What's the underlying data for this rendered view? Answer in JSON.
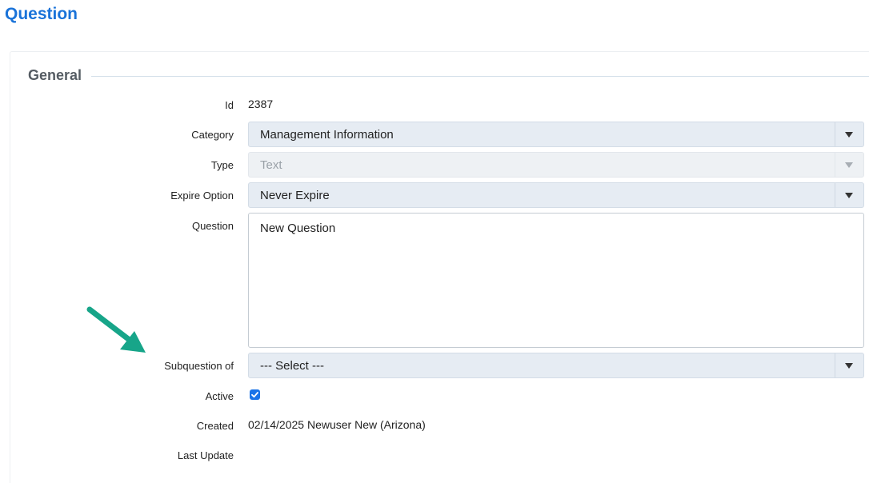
{
  "page": {
    "title": "Question"
  },
  "section": {
    "legend": "General"
  },
  "form": {
    "id_label": "Id",
    "id_value": "2387",
    "category_label": "Category",
    "category_value": "Management Information",
    "type_label": "Type",
    "type_value": "Text",
    "expire_label": "Expire Option",
    "expire_value": "Never Expire",
    "question_label": "Question",
    "question_value": "New Question",
    "subquestion_label": "Subquestion of",
    "subquestion_value": "--- Select ---",
    "active_label": "Active",
    "active_checked": true,
    "created_label": "Created",
    "created_value": "02/14/2025 Newuser New (Arizona)",
    "last_update_label": "Last Update",
    "last_update_value": ""
  },
  "icons": {
    "dropdown": "chevron-down-icon",
    "checkbox": "checkmark-icon",
    "annotation": "arrow-icon"
  },
  "colors": {
    "title": "#1a73d9",
    "select_bg": "#e6ecf3",
    "checkbox": "#1a73e8",
    "annotation_arrow": "#17a589"
  }
}
